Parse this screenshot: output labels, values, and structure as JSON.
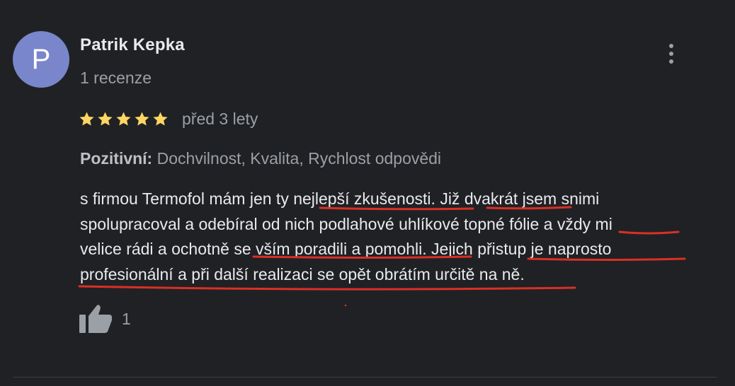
{
  "review": {
    "author": {
      "initial": "P",
      "name": "Patrik Kepka",
      "meta": "1 recenze",
      "avatar_color": "#7986cb"
    },
    "menu_icon": "more-vert-icon",
    "rating": 5,
    "date": "před 3 lety",
    "attributes": {
      "label": "Pozitivní:",
      "value": "Dochvilnost, Kvalita, Rychlost odpovědi"
    },
    "text_lines": [
      "s firmou Termofol mám jen ty nejlepší zkušenosti. Již dvakrát jsem snimi",
      "spolupracoval a odebíral od nich podlahové uhlíkové topné fólie a vždy mi",
      "velice rádi a ochotně se vším poradili a pomohli. Jejich přistup je naprosto",
      "profesionální a při další realizaci se opět obrátím určitě na ně."
    ],
    "like": {
      "icon": "thumb-up-icon",
      "count": "1"
    }
  },
  "colors": {
    "background": "#202124",
    "star": "#fdd663",
    "text_primary": "#e8eaed",
    "text_secondary": "#9aa0a6",
    "annotation_underline": "#d93025"
  }
}
